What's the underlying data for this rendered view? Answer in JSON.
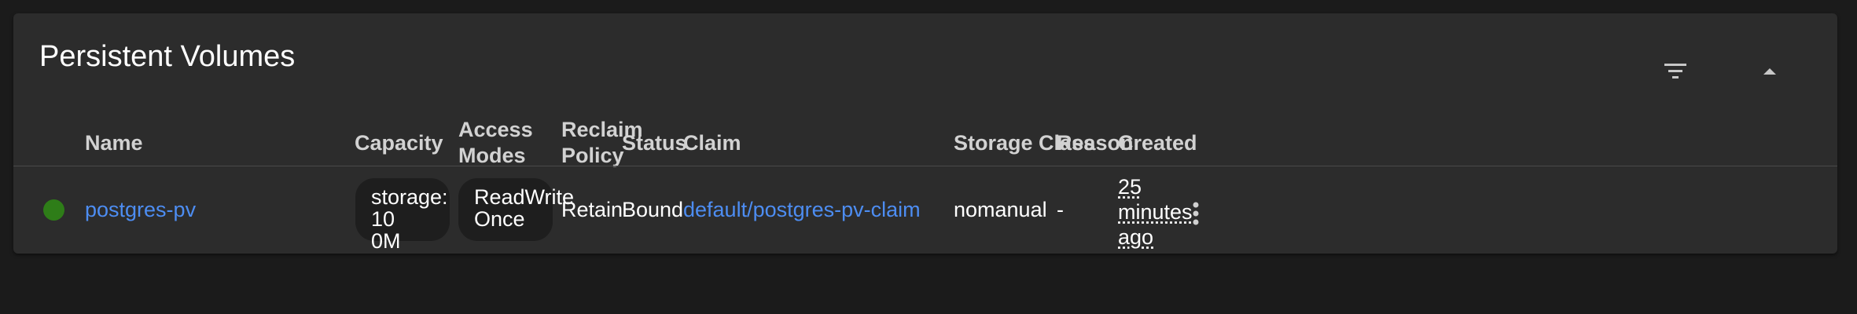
{
  "card": {
    "title": "Persistent Volumes"
  },
  "icons": {
    "filter": "filter-list-icon",
    "collapse": "chevron-up-icon",
    "row_menu": "more-vert-icon",
    "status": "status-dot-icon"
  },
  "colors": {
    "status_ok": "#2e7d18",
    "link": "#4d8df2",
    "card_bg": "#2c2c2c",
    "page_bg": "#1b1b1b"
  },
  "table": {
    "headers": {
      "name": "Name",
      "capacity": "Capacity",
      "access_modes_1": "Access",
      "access_modes_2": "Modes",
      "reclaim_1": "Reclaim",
      "reclaim_2": "Policy",
      "status": "Status",
      "claim": "Claim",
      "storage_class": "Storage Class",
      "reason": "Reason",
      "created": "Created"
    },
    "rows": [
      {
        "name": "postgres-pv",
        "capacity_1": "storage: 10",
        "capacity_2": "0M",
        "access_modes_1": "ReadWrite",
        "access_modes_2": "Once",
        "reclaim_policy": "Retain",
        "status": "Bound",
        "claim": "default/postgres-pv-claim",
        "storage_class": "nomanual",
        "reason": "-",
        "created_1": "25",
        "created_2": "minutes",
        "created_3": "ago"
      }
    ]
  }
}
